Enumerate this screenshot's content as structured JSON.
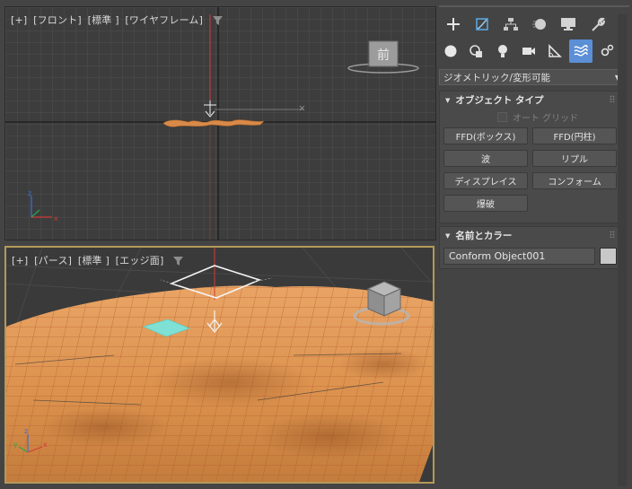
{
  "viewports": {
    "top": {
      "labels": [
        "[+]",
        "[フロント]",
        "[標準 ]",
        "[ワイヤフレーム]"
      ],
      "view_cube_label": "前"
    },
    "perspective": {
      "labels": [
        "[+]",
        "[パース]",
        "[標準 ]",
        "[エッジ面]"
      ]
    }
  },
  "command_panel": {
    "main_tabs": [
      {
        "icon": "create-plus-icon"
      },
      {
        "icon": "modify-icon"
      },
      {
        "icon": "hierarchy-icon"
      },
      {
        "icon": "motion-icon"
      },
      {
        "icon": "display-icon"
      },
      {
        "icon": "utilities-wrench-icon"
      }
    ],
    "sub_tabs": [
      {
        "icon": "geometry-sphere-icon"
      },
      {
        "icon": "shapes-icon"
      },
      {
        "icon": "lights-icon"
      },
      {
        "icon": "cameras-icon"
      },
      {
        "icon": "helpers-icon"
      },
      {
        "icon": "space-warps-icon",
        "active": true
      },
      {
        "icon": "systems-icon"
      }
    ],
    "category_dropdown": "ジオメトリック/変形可能",
    "object_type": {
      "title": "オブジェクト タイプ",
      "auto_grid_label": "オート グリッド",
      "buttons": [
        "FFD(ボックス)",
        "FFD(円柱)",
        "波",
        "リプル",
        "ディスプレイス",
        "コンフォーム",
        "爆破"
      ]
    },
    "name_color": {
      "title": "名前とカラー",
      "name_value": "Conform Object001",
      "color": "#c8c8c8"
    }
  },
  "colors": {
    "active_tab": "#5b8fd6",
    "terrain": "#d98a48",
    "active_viewport_border": "#b39a5a",
    "deform_object": "#7fe0d6"
  }
}
